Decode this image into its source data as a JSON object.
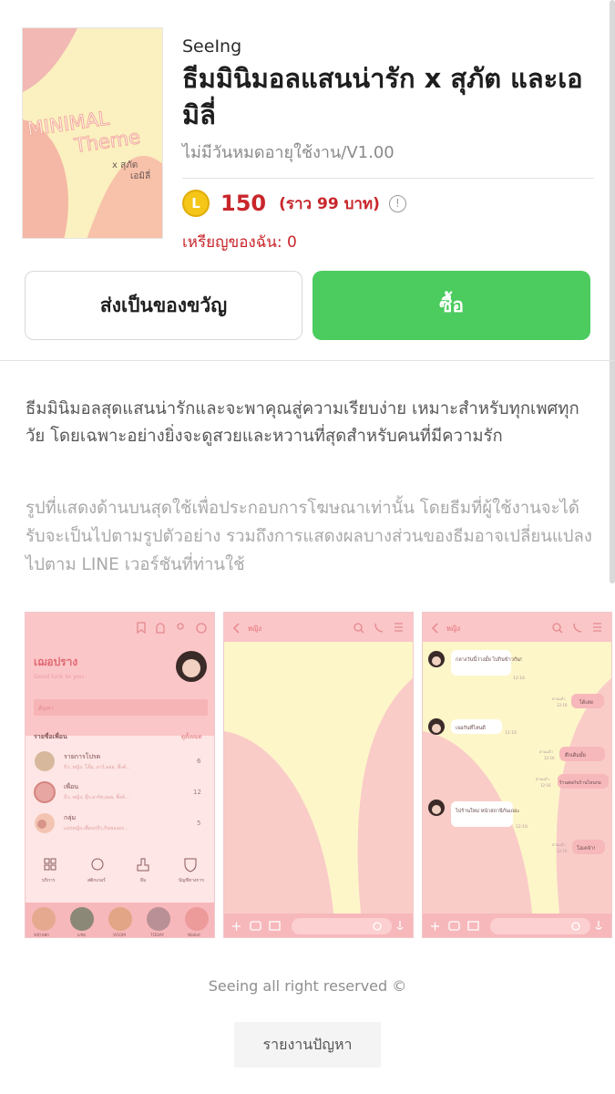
{
  "theme": {
    "author": "SeeIng",
    "title": "ธีมมินิมอลแสนน่ารัก x สุภัต และเอมิลี่",
    "validity": "ไม่มีวันหมดอายุใช้งาน/V1.00",
    "coin_letter": "L",
    "price": "150",
    "approx_price": "(ราว 99 บาท)",
    "my_coins": "เหรียญของฉัน: 0",
    "thumbnail_text": {
      "line1": "MINIMAL",
      "line2": "Theme",
      "line3": "x สุภัต",
      "line4": "เอมิลี่"
    }
  },
  "actions": {
    "gift_label": "ส่งเป็นของขวัญ",
    "buy_label": "ซื้อ"
  },
  "description": "ธีมมินิมอลสุดแสนน่ารักและจะพาคุณสู่ความเรียบง่าย เหมาะสำหรับทุกเพศทุกวัย โดยเฉพาะอย่างยิ่งจะดูสวยและหวานที่สุดสำหรับคนที่มีความรัก",
  "disclaimer": "รูปที่แสดงด้านบนสุดใช้เพื่อประกอบการโฆษณาเท่านั้น โดยธีมที่ผู้ใช้งานจะได้รับจะเป็นไปตามรูปตัวอย่าง รวมถึงการแสดงผลบางส่วนของธีมอาจเปลี่ยนแปลงไปตาม LINE เวอร์ชันที่ท่านใช้",
  "preview1": {
    "profile_name": "เฌอปราง",
    "status": "Good luck to you",
    "search_placeholder": "ค้นหา",
    "friends_header": "รายชื่อเพื่อน",
    "see_all": "ดูทั้งหมด",
    "rows": [
      {
        "title": "รายการโปรด",
        "sub": "บีว, หญิง, โอ๊ม, อาร์,ออย, พิ้งค์...",
        "count": "6"
      },
      {
        "title": "เพื่อน",
        "sub": "บีว, หญิง, จุ๊ก,อาร์ท,ออย, พิ้งค์...",
        "count": "12"
      },
      {
        "title": "กลุ่ม",
        "sub": "แม่ๆหญิง,เพื่อนๆปีว,กินของอร่...",
        "count": "5"
      }
    ],
    "nav": [
      "บริการ",
      "สติกเกอร์",
      "ธีม",
      "บัญชีทางการ"
    ],
    "bottom_tabs": [
      "หน้าหลัก",
      "แชท",
      "VOOM",
      "TODAY",
      "Wallet"
    ]
  },
  "preview2": {
    "chat_title": "หญิง"
  },
  "preview3": {
    "chat_title": "หญิง",
    "messages": [
      {
        "side": "left",
        "text": "กลางวันนี้ว่างมั้ย ไปกินข้าวกัน!",
        "time": "12:16"
      },
      {
        "side": "right",
        "text": "ได้เลย",
        "read": "อ่านแล้ว",
        "time": "12:16"
      },
      {
        "side": "left",
        "text": "เจอกันที่ไหนดี",
        "time": "12:16"
      },
      {
        "side": "right",
        "text": "ตึกเดิมมั้ย",
        "read": "อ่านแล้ว",
        "time": "12:16"
      },
      {
        "side": "right",
        "text": "ร้านต่อกันร้านไหนก่อ",
        "read": "อ่านแล้ว",
        "time": "12:16"
      },
      {
        "side": "left",
        "text": "ไปร้านใหม่ หน้าสถานีกันเถอะ",
        "time": "12:16"
      },
      {
        "side": "right",
        "text": "โอเคจ้า!",
        "read": "อ่านแล้ว",
        "time": "12:16"
      }
    ]
  },
  "footer": {
    "copyright": "Seeing all right reserved ©",
    "report_label": "รายงานปัญหา"
  },
  "colors": {
    "accent_green": "#4ccb5f",
    "price_red": "#c8262b",
    "theme_pink": "#fde1e1",
    "theme_cream": "#fdf6c9",
    "theme_rose": "#f5b8bb"
  }
}
